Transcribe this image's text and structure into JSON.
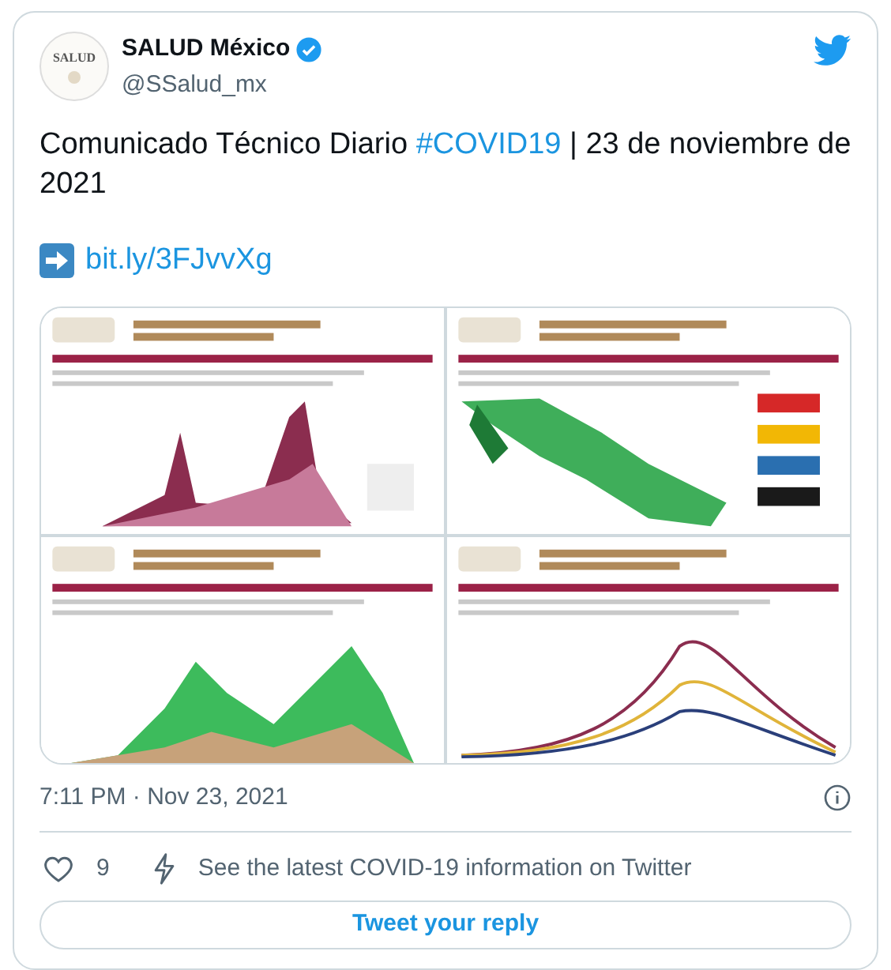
{
  "author": {
    "avatar_text": "SALUD",
    "name": "SALUD México",
    "verified": true,
    "handle": "@SSalud_mx"
  },
  "tweet": {
    "text_before": "Comunicado Técnico Diario ",
    "hashtag": "#COVID19",
    "text_after": " | 23 de noviembre de 2021",
    "link": "bit.ly/3FJvvXg"
  },
  "timestamp": "7:11 PM · Nov 23, 2021",
  "actions": {
    "likes": "9",
    "covid_info": "See the latest COVID-19 information on Twitter"
  },
  "reply_button": "Tweet your reply"
}
